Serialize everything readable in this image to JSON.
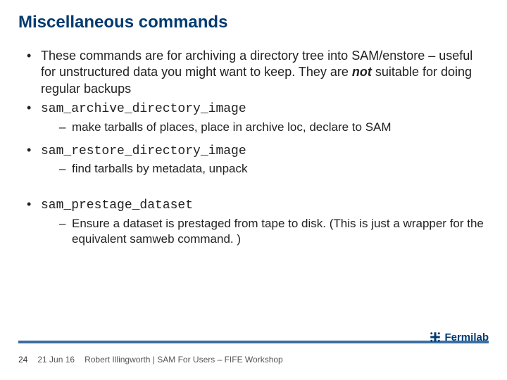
{
  "title": "Miscellaneous commands",
  "bullets": {
    "intro_a": "These commands are for archiving a directory tree into SAM/enstore – useful for unstructured data you might want to keep. They are ",
    "intro_not": "not",
    "intro_b": " suitable for doing regular backups",
    "cmd1": "sam_archive_directory_image",
    "cmd1_sub": "make tarballs of places, place in archive loc, declare to SAM",
    "cmd2": "sam_restore_directory_image",
    "cmd2_sub": "find tarballs by metadata, unpack",
    "cmd3": "sam_prestage_dataset",
    "cmd3_sub": "Ensure a dataset is prestaged from tape to disk. (This is just a wrapper for the equivalent samweb command. )"
  },
  "footer": {
    "page": "24",
    "date": "21 Jun 16",
    "attribution": "Robert Illingworth | SAM For Users – FIFE Workshop"
  },
  "logo_text": "Fermilab"
}
